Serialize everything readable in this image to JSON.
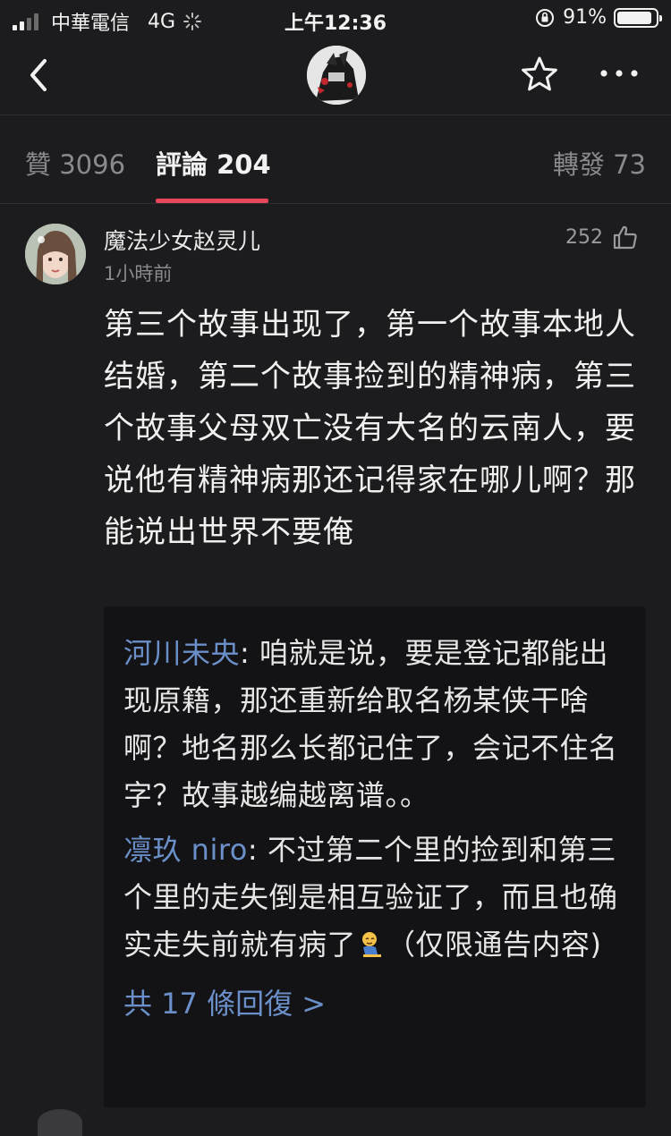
{
  "status_bar": {
    "carrier": "中華電信",
    "network": "4G",
    "time": "上午12:36",
    "battery_percent": "91%",
    "battery_level": 0.91
  },
  "nav": {
    "back_icon": "chevron-left-icon",
    "star_icon": "star-outline-icon",
    "more_icon": "more-dots-icon"
  },
  "tabs": {
    "likes": "贊 3096",
    "comments": "評論 204",
    "reposts": "轉發 73"
  },
  "comment": {
    "username": "魔法少女赵灵儿",
    "time": "1小時前",
    "like_count": "252",
    "text": "第三个故事出现了，第一个故事本地人结婚，第二个故事捡到的精神病，第三个故事父母双亡没有大名的云南人，要说他有精神病那还记得家在哪儿啊？那能说出世界不要俺",
    "replies": [
      {
        "author": "河川未央",
        "separator": ": ",
        "text": "咱就是说，要是登记都能出现原籍，那还重新给取名杨某侠干啥啊？地名那么长都记住了，会记不住名字？故事越编越离谱。。"
      },
      {
        "author": "凛玖 niro",
        "separator": ": ",
        "text_before_emoji": "不过第二个里的捡到和第三个里的走失倒是相互验证了，而且也确实走失前就有病了",
        "emoji": "kneeling-person-emoji",
        "text_after_emoji": "（仅限通告内容)"
      }
    ],
    "more_replies": "共 17 條回復 >"
  },
  "colors": {
    "background": "#1c1c1e",
    "accent": "#e8475b",
    "link": "#6b8fc9"
  }
}
